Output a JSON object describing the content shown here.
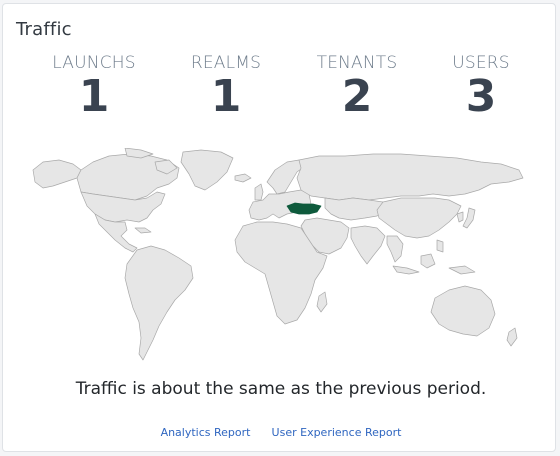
{
  "card": {
    "title": "Traffic"
  },
  "stats": [
    {
      "label": "LAUNCHS",
      "value": "1"
    },
    {
      "label": "REALMS",
      "value": "1"
    },
    {
      "label": "TENANTS",
      "value": "2"
    },
    {
      "label": "USERS",
      "value": "3"
    }
  ],
  "map": {
    "land_color": "#e6e6e6",
    "border_color": "#a9a9a9",
    "highlight_color": "#0e5a3c",
    "highlighted_country": "Turkey"
  },
  "summary": "Traffic is about the same as the previous period.",
  "links": {
    "analytics": "Analytics Report",
    "ux": "User Experience Report"
  }
}
